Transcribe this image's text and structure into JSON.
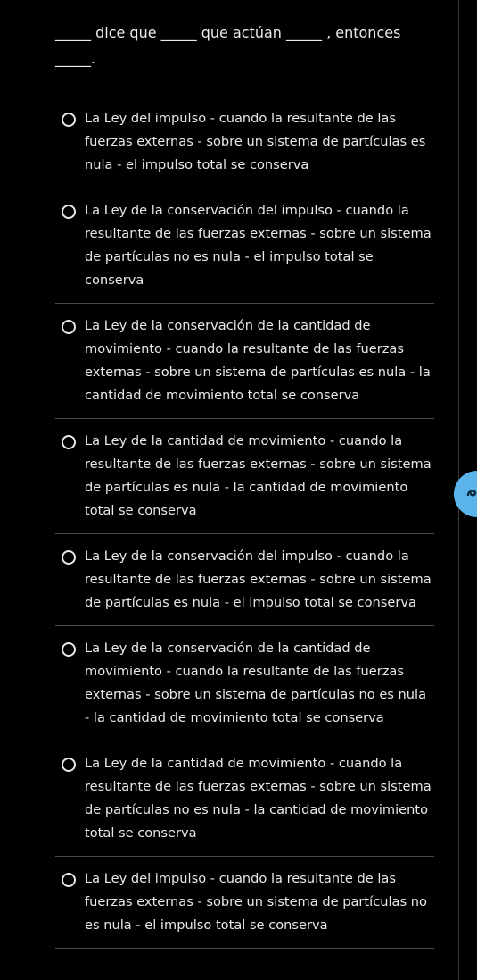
{
  "question": {
    "text": "_____ dice que _____ que actúan _____ , entonces _____."
  },
  "options": [
    {
      "label": "La Ley del impulso -  cuando la resultante de las fuerzas externas - sobre un sistema de partículas es nula - el impulso total se conserva"
    },
    {
      "label": "La Ley de la conservación del impulso -  cuando la resultante de las fuerzas externas - sobre un sistema de partículas no es nula - el impulso total se conserva"
    },
    {
      "label": "La Ley de la conservación de la cantidad de movimiento -  cuando la resultante de las fuerzas externas - sobre un sistema de partículas es nula - la cantidad de movimiento total se conserva"
    },
    {
      "label": "La Ley de la cantidad de movimiento -  cuando la resultante de las fuerzas externas - sobre un sistema de partículas es nula - la cantidad de movimiento total se conserva"
    },
    {
      "label": "La Ley de la conservación del impulso -  cuando la resultante de las fuerzas externas - sobre un sistema de partículas es nula - el impulso total se conserva"
    },
    {
      "label": "La Ley de la conservación de la cantidad de movimiento -  cuando la resultante de las fuerzas externas - sobre un sistema de partículas no es nula - la cantidad de movimiento total se conserva"
    },
    {
      "label": "La Ley de la cantidad de movimiento -  cuando la resultante de las fuerzas externas - sobre un sistema de partículas no es nula - la cantidad de movimiento total se conserva"
    },
    {
      "label": "La Ley del impulso -  cuando la resultante de las fuerzas externas - sobre un sistema de partículas no es nula - el impulso total se conserva"
    }
  ],
  "side_button": {
    "icon": "swirl-icon",
    "color": "#5ab4ea"
  },
  "colors": {
    "background": "#000000",
    "text": "#e8e8e8",
    "divider": "#4a4a4a"
  }
}
